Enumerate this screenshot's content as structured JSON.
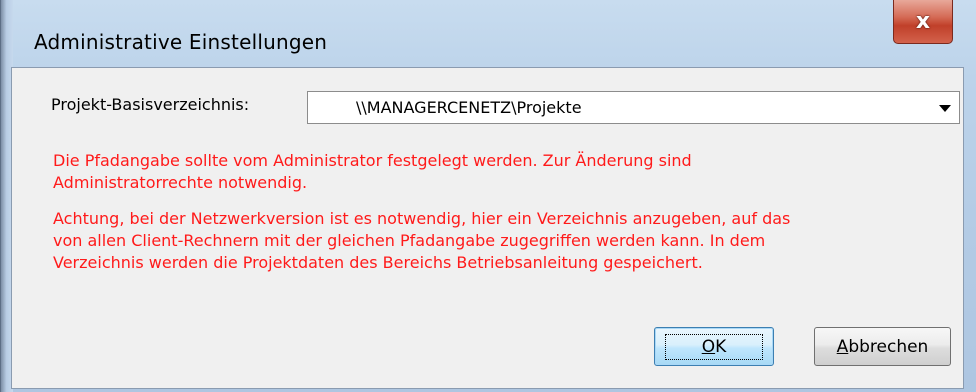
{
  "window": {
    "title": "Administrative Einstellungen",
    "close_glyph": "x"
  },
  "form": {
    "label": "Projekt-Basisverzeichnis:",
    "combo_value": "\\\\MANAGERCENETZ\\Projekte"
  },
  "messages": {
    "line1": "Die Pfadangabe sollte vom Administrator festgelegt werden. Zur Änderung sind",
    "line2": "Administratorrechte notwendig.",
    "line3": "Achtung, bei der Netzwerkversion ist es notwendig, hier ein Verzeichnis anzugeben, auf das",
    "line4": "von allen Client-Rechnern mit der gleichen Pfadangabe zugegriffen werden kann. In dem",
    "line5": "Verzeichnis werden die Projektdaten des Bereichs Betriebsanleitung gespeichert."
  },
  "buttons": {
    "ok_mnemonic": "O",
    "ok_rest": "K",
    "cancel_mnemonic": "A",
    "cancel_rest": "bbrechen"
  },
  "colors": {
    "warning_text": "#ff1a1a",
    "close_button": "#c0402a"
  }
}
